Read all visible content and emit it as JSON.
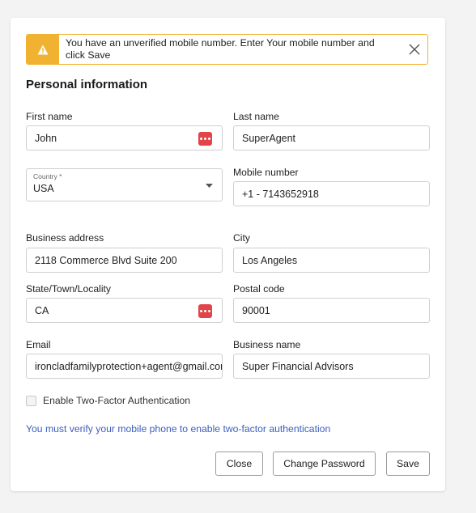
{
  "alert": {
    "message": "You have an unverified mobile number. Enter Your mobile number and click Save",
    "icon": "warning-icon",
    "close_icon": "close-icon",
    "color": "#f2b231"
  },
  "section_title": "Personal information",
  "fields": {
    "first_name": {
      "label": "First name",
      "value": "John"
    },
    "last_name": {
      "label": "Last name",
      "value": "SuperAgent"
    },
    "country": {
      "label": "Country *",
      "value": "USA"
    },
    "mobile": {
      "label": "Mobile number",
      "value": "+1 - 7143652918"
    },
    "business_address": {
      "label": "Business address",
      "value": "2118 Commerce Blvd Suite 200"
    },
    "city": {
      "label": "City",
      "value": "Los Angeles"
    },
    "state": {
      "label": "State/Town/Locality",
      "value": "CA"
    },
    "postal_code": {
      "label": "Postal code",
      "value": "90001"
    },
    "email": {
      "label": "Email",
      "value": "ironcladfamilyprotection+agent@gmail.com"
    },
    "business_name": {
      "label": "Business name",
      "value": "Super Financial Advisors"
    }
  },
  "two_factor": {
    "label": "Enable Two-Factor Authentication",
    "checked": false
  },
  "notice": "You must verify your mobile phone to enable two-factor authentication",
  "buttons": {
    "close": "Close",
    "change_password": "Change Password",
    "save": "Save"
  },
  "colors": {
    "link": "#3b5fc0",
    "password_manager_icon": "#e2444a"
  }
}
